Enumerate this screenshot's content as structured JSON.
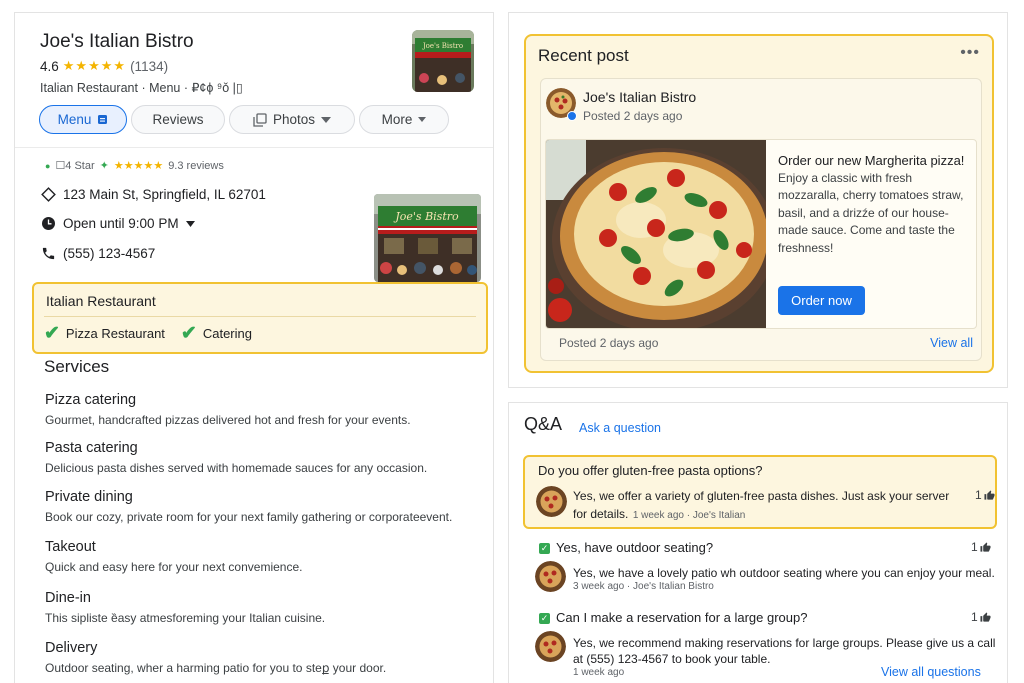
{
  "business": {
    "name": "Joe's Italian Bistro",
    "rating": "4.6",
    "stars": "★★★★★",
    "review_count": "(1134)",
    "category_line": "Italian Restaurant · Menu · ₽¢ϕ ⁹ǒ |▯"
  },
  "tabs": [
    {
      "label": "Menu"
    },
    {
      "label": "Reviews"
    },
    {
      "label": "Photos"
    },
    {
      "label": "More"
    }
  ],
  "meta": {
    "label": "☐4 Star",
    "stars": "★★★★★",
    "reviews": "9.3 reviews"
  },
  "info": {
    "address": "123 Main St, Springfield, IL 62701",
    "hours": "Open until 9:00 PM",
    "phone": "(555) 123-4567"
  },
  "categories": {
    "primary": "Italian Restaurant",
    "tags": [
      "Pizza Restaurant",
      "Catering"
    ]
  },
  "services": {
    "heading": "Services",
    "items": [
      {
        "name": "Pizza catering",
        "desc": "Gourmet, handcrafted pizzas delivered hot and fresh for your events."
      },
      {
        "name": "Pasta catering",
        "desc": "Delicious pasta dishes served with homemade sauces for any occasion."
      },
      {
        "name": "Private dining",
        "desc": "Book our cozy, private room for your next family gathering or corporateevent."
      },
      {
        "name": "Takeout",
        "desc": "Quick and easy here for your next convemience."
      },
      {
        "name": "Dine-in",
        "desc": "This sipliste ȅasy atmesforeming your Italian cuisine."
      },
      {
        "name": "Delivery",
        "desc": "Outdoor seating, wher a harming patio for you to steք your door."
      }
    ]
  },
  "recent_post": {
    "title": "Recent post",
    "menu": "•••",
    "author": "Joe's Italian Bistro",
    "posted": "Posted 2 days ago",
    "headline": "Order our new Margherita pizza!",
    "body": "Enjoy a classic with fresh mozzaralla, cherry tomatoes straw, basil, and a drizźe of our house-made sauce. Come and taste the freshness!",
    "button": "Order now",
    "footer_time": "Posted 2 days ago",
    "view_all": "View all"
  },
  "qa": {
    "title": "Q&A",
    "ask": "Ask a question",
    "items": [
      {
        "question": "Do you offer gluten-free pasta options?",
        "answer": "Yes, we offer a variety of gluten-free pasta dishes. Just ask your server for details.",
        "meta": "1 week ago · Joe's Italian",
        "likes": "1"
      },
      {
        "question": "Yes, have outdoor seating?",
        "answer": "Yes, we have a lovely patio wh outdoor seating where you can enjoy your meal.",
        "meta": "3 week ago · Joe's Italian Bistro",
        "likes": "1"
      },
      {
        "question": "Can I make a reservation for a large group?",
        "answer": "Yes, we recommend making reservations for large groups. Please give us a call at (555) 123-4567 to book your table.",
        "meta": "1 week ago",
        "likes": "1"
      }
    ],
    "view_all": "View all questions"
  },
  "colors": {
    "accent": "#1a73e8",
    "highlight": "#f1c232",
    "highlight_bg": "#fdf6df",
    "star": "#f4b400",
    "check": "#34a853"
  }
}
